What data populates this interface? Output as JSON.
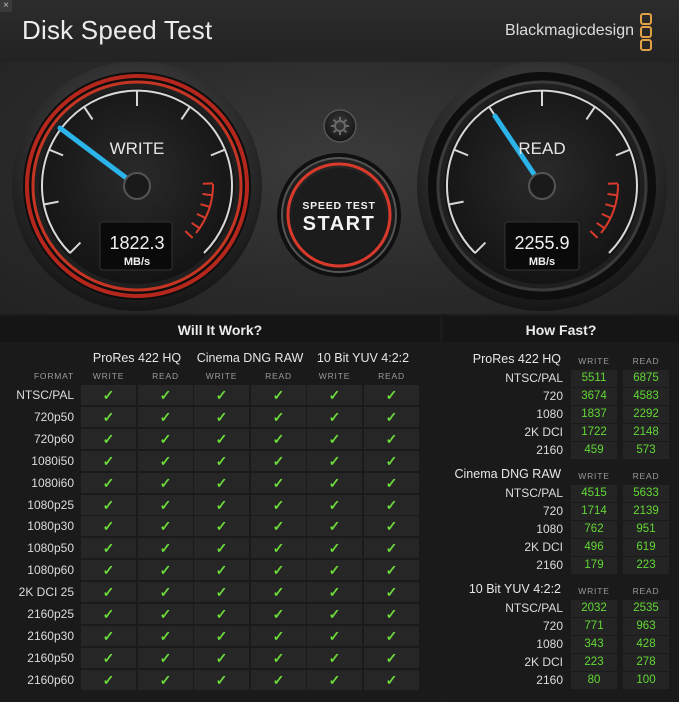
{
  "app_title": "Disk Speed Test",
  "brand": "Blackmagicdesign",
  "close_icon": "×",
  "gauges": {
    "write": {
      "label": "WRITE",
      "value": "1822.3",
      "unit": "MB/s",
      "needle_fraction": 0.27
    },
    "read": {
      "label": "READ",
      "value": "2255.9",
      "unit": "MB/s",
      "needle_fraction": 0.33
    }
  },
  "start_button": {
    "line1": "SPEED TEST",
    "line2": "START"
  },
  "settings_icon": "gear-icon",
  "will_it_work": {
    "title": "Will It Work?",
    "format_header": "FORMAT",
    "groups": [
      "ProRes 422 HQ",
      "Cinema DNG RAW",
      "10 Bit YUV 4:2:2"
    ],
    "sub_headers": [
      "WRITE",
      "READ"
    ],
    "check": "✓",
    "rows": [
      "NTSC/PAL",
      "720p50",
      "720p60",
      "1080i50",
      "1080i60",
      "1080p25",
      "1080p30",
      "1080p50",
      "1080p60",
      "2K DCI 25",
      "2160p25",
      "2160p30",
      "2160p50",
      "2160p60"
    ]
  },
  "how_fast": {
    "title": "How Fast?",
    "sub_headers": [
      "WRITE",
      "READ"
    ],
    "sections": [
      {
        "name": "ProRes 422 HQ",
        "rows": [
          {
            "label": "NTSC/PAL",
            "write": "5511",
            "read": "6875"
          },
          {
            "label": "720",
            "write": "3674",
            "read": "4583"
          },
          {
            "label": "1080",
            "write": "1837",
            "read": "2292"
          },
          {
            "label": "2K DCI",
            "write": "1722",
            "read": "2148"
          },
          {
            "label": "2160",
            "write": "459",
            "read": "573"
          }
        ]
      },
      {
        "name": "Cinema DNG RAW",
        "rows": [
          {
            "label": "NTSC/PAL",
            "write": "4515",
            "read": "5633"
          },
          {
            "label": "720",
            "write": "1714",
            "read": "2139"
          },
          {
            "label": "1080",
            "write": "762",
            "read": "951"
          },
          {
            "label": "2K DCI",
            "write": "496",
            "read": "619"
          },
          {
            "label": "2160",
            "write": "179",
            "read": "223"
          }
        ]
      },
      {
        "name": "10 Bit YUV 4:2:2",
        "rows": [
          {
            "label": "NTSC/PAL",
            "write": "2032",
            "read": "2535"
          },
          {
            "label": "720",
            "write": "771",
            "read": "963"
          },
          {
            "label": "1080",
            "write": "343",
            "read": "428"
          },
          {
            "label": "2K DCI",
            "write": "223",
            "read": "278"
          },
          {
            "label": "2160",
            "write": "80",
            "read": "100"
          }
        ]
      }
    ]
  },
  "colors": {
    "accent_red": "#d93a2b",
    "needle": "#2ab4ea",
    "check_green": "#6cdb3a",
    "brand_orange": "#e0a044"
  }
}
